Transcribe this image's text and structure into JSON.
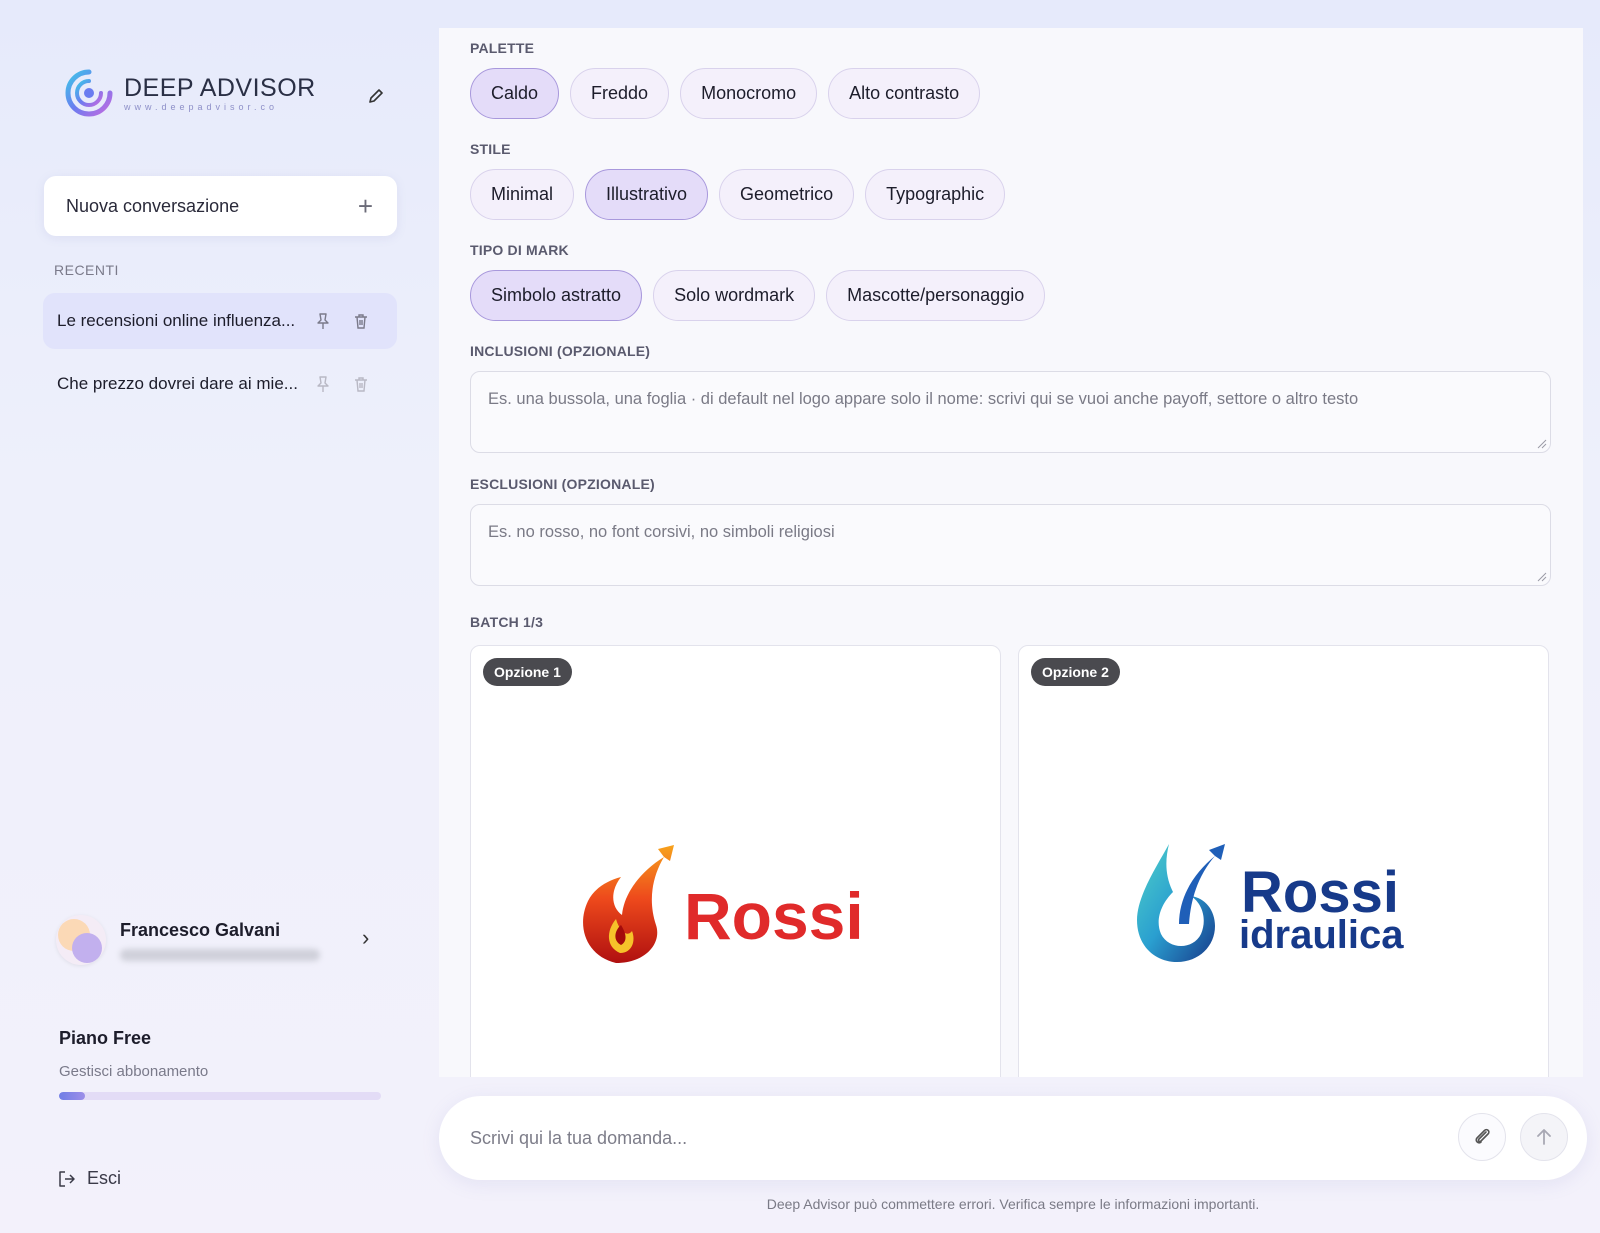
{
  "sidebar": {
    "brand": {
      "title": "DEEP ADVISOR",
      "subtitle": "www.deepadvisor.co"
    },
    "new_conversation": "Nuova conversazione",
    "recent_label": "RECENTI",
    "conversations": [
      {
        "title": "Le recensioni online influenza...",
        "active": true
      },
      {
        "title": "Che prezzo dovrei dare ai mie...",
        "active": false
      }
    ],
    "user": {
      "name": "Francesco Galvani"
    },
    "plan": {
      "name": "Piano Free",
      "manage": "Gestisci abbonamento",
      "usage_fraction": 0.08
    },
    "logout": "Esci"
  },
  "form": {
    "palette": {
      "label": "PALETTE",
      "options": [
        "Caldo",
        "Freddo",
        "Monocromo",
        "Alto contrasto"
      ],
      "selected": "Caldo"
    },
    "style": {
      "label": "STILE",
      "options": [
        "Minimal",
        "Illustrativo",
        "Geometrico",
        "Typographic"
      ],
      "selected": "Illustrativo"
    },
    "mark_type": {
      "label": "TIPO DI MARK",
      "options": [
        "Simbolo astratto",
        "Solo wordmark",
        "Mascotte/personaggio"
      ],
      "selected": "Simbolo astratto"
    },
    "inclusions": {
      "label": "INCLUSIONI (OPZIONALE)",
      "placeholder": "Es. una bussola, una foglia · di default nel logo appare solo il nome: scrivi qui se vuoi anche payoff, settore o altro testo"
    },
    "exclusions": {
      "label": "ESCLUSIONI (OPZIONALE)",
      "placeholder": "Es. no rosso, no font corsivi, no simboli religiosi"
    }
  },
  "batch": {
    "label": "BATCH 1/3",
    "options": [
      {
        "badge": "Opzione 1",
        "logo_text": "Rossi",
        "logo_color": "#e02a2a"
      },
      {
        "badge": "Opzione 2",
        "logo_text": "Rossi",
        "logo_subtext": "idraulica",
        "logo_color": "#173a8a"
      }
    ]
  },
  "chat": {
    "placeholder": "Scrivi qui la tua domanda...",
    "disclaimer": "Deep Advisor può commettere errori. Verifica sempre le informazioni importanti."
  }
}
